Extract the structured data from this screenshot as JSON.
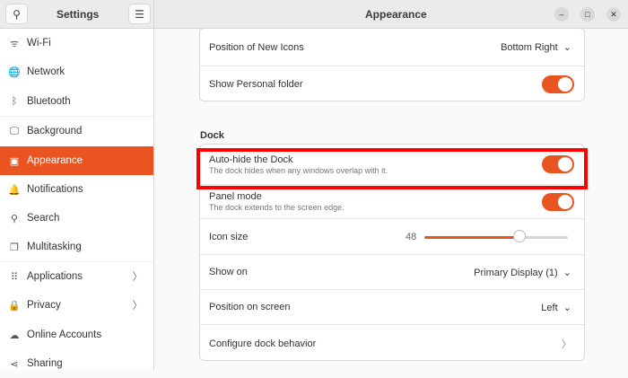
{
  "sidebar": {
    "title": "Settings",
    "items": [
      {
        "label": "Wi-Fi",
        "icon": "wifi-icon",
        "glyph": "ᯤ"
      },
      {
        "label": "Network",
        "icon": "globe-icon",
        "glyph": "🌐"
      },
      {
        "label": "Bluetooth",
        "icon": "bluetooth-icon",
        "glyph": "ᛒ"
      },
      {
        "label": "Background",
        "icon": "monitor-icon",
        "glyph": "🖵"
      },
      {
        "label": "Appearance",
        "icon": "appearance-icon",
        "glyph": "▣"
      },
      {
        "label": "Notifications",
        "icon": "bell-icon",
        "glyph": "🔔"
      },
      {
        "label": "Search",
        "icon": "search-icon",
        "glyph": "⚲"
      },
      {
        "label": "Multitasking",
        "icon": "multitasking-icon",
        "glyph": "❐"
      },
      {
        "label": "Applications",
        "icon": "grid-icon",
        "glyph": "⠿"
      },
      {
        "label": "Privacy",
        "icon": "lock-icon",
        "glyph": "🔒"
      },
      {
        "label": "Online Accounts",
        "icon": "cloud-icon",
        "glyph": "☁"
      },
      {
        "label": "Sharing",
        "icon": "share-icon",
        "glyph": "⋖"
      }
    ]
  },
  "header": {
    "title": "Appearance"
  },
  "desktop_icons": {
    "position_label": "Position of New Icons",
    "position_value": "Bottom Right",
    "personal_folder_label": "Show Personal folder",
    "personal_folder_on": true
  },
  "dock": {
    "heading": "Dock",
    "autohide": {
      "label": "Auto-hide the Dock",
      "sub": "The dock hides when any windows overlap with it.",
      "on": true
    },
    "panel": {
      "label": "Panel mode",
      "sub": "The dock extends to the screen edge.",
      "on": true
    },
    "icon_size": {
      "label": "Icon size",
      "value": "48",
      "fraction": 0.66
    },
    "show_on": {
      "label": "Show on",
      "value": "Primary Display (1)"
    },
    "position": {
      "label": "Position on screen",
      "value": "Left"
    },
    "configure": {
      "label": "Configure dock behavior"
    }
  },
  "accent": "#e95420"
}
